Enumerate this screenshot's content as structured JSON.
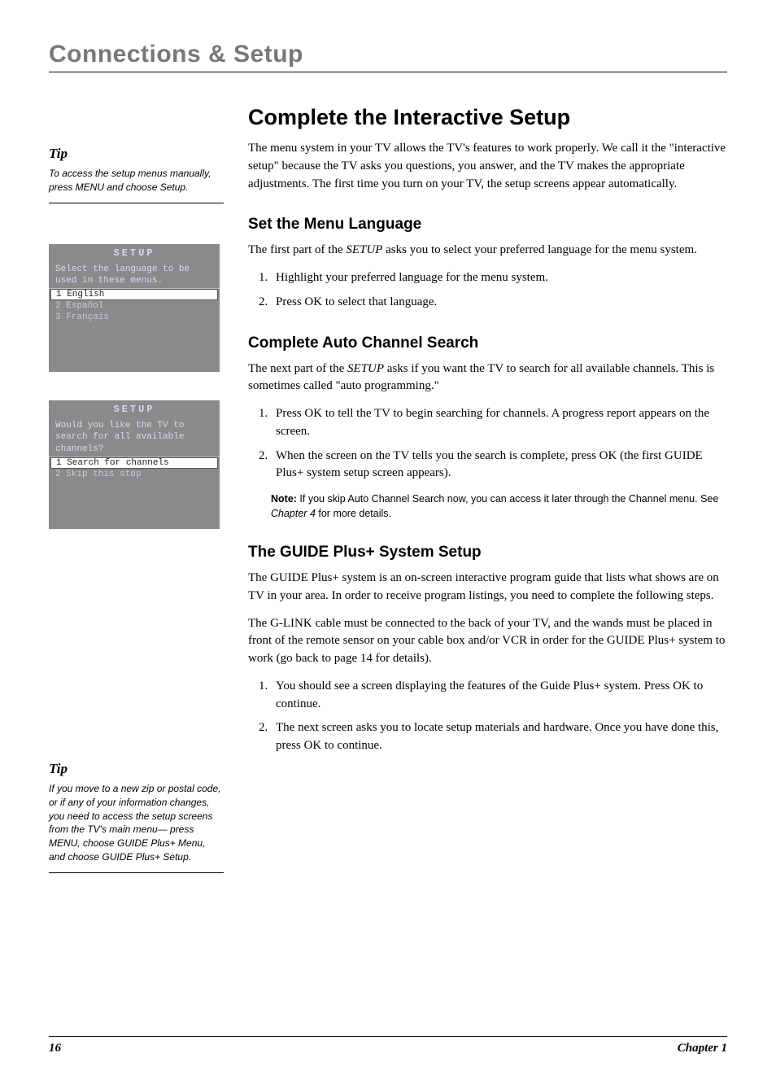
{
  "header": "Connections & Setup",
  "main": {
    "title": "Complete the Interactive Setup",
    "intro": "The menu system in your TV allows the TV's features to work properly. We call it the \"interactive setup\" because the TV asks you questions, you answer, and the TV makes the appropriate adjustments. The first time you turn on your TV, the setup screens appear automatically.",
    "section1": {
      "title": "Set the Menu Language",
      "p1a": "The first part of the ",
      "p1b": "SETUP",
      "p1c": " asks you to select your preferred language for the menu system.",
      "li1": "Highlight your preferred language for the menu system.",
      "li2": "Press OK to select that language."
    },
    "section2": {
      "title": "Complete Auto Channel Search",
      "p1a": "The next part of the ",
      "p1b": "SETUP",
      "p1c": " asks if you want the TV to search for all available channels. This is sometimes called \"auto programming.\"",
      "li1": "Press OK to tell the TV to begin searching for channels. A progress report appears on the screen.",
      "li2": "When the screen on the TV tells you the search is complete, press OK (the first GUIDE Plus+ system setup screen appears).",
      "note_label": "Note:",
      "note_a": "  If you skip Auto Channel Search now, you can access it later through the Channel menu. See ",
      "note_ref": "Chapter 4",
      "note_b": " for more details."
    },
    "section3": {
      "title": "The GUIDE Plus+ System Setup",
      "p1": "The GUIDE Plus+ system is an on-screen interactive program guide that lists what shows are on TV in your area. In order to receive program listings, you need to complete the following steps.",
      "p2": "The G-LINK cable must be connected to the back of your TV, and the wands must be placed in front of the remote sensor on your cable box and/or VCR in order for the GUIDE Plus+ system to work (go back to page 14 for details).",
      "li1": "You should see a screen displaying the features of the Guide Plus+ system. Press OK to continue.",
      "li2": "The next screen asks you to locate setup materials and hardware. Once you have done this, press OK to continue."
    }
  },
  "sidebar": {
    "tip1": {
      "heading": "Tip",
      "text": "To access the setup menus manually, press MENU and choose Setup."
    },
    "box1": {
      "title": "SETUP",
      "prompt": "Select the language to be used in these menus.",
      "opt1": "1 English",
      "opt2": "2 Español",
      "opt3": "3 Français"
    },
    "box2": {
      "title": "SETUP",
      "prompt": "Would you like the TV to search for all available channels?",
      "opt1": "1 Search for channels",
      "opt2": "2 Skip this step"
    },
    "tip2": {
      "heading": "Tip",
      "text": "If you move to a new zip or postal code, or if any of your information changes, you need to access the setup screens from the TV's main menu— press MENU, choose GUIDE Plus+ Menu, and choose GUIDE Plus+ Setup."
    }
  },
  "footer": {
    "page": "16",
    "chapter": "Chapter 1"
  }
}
